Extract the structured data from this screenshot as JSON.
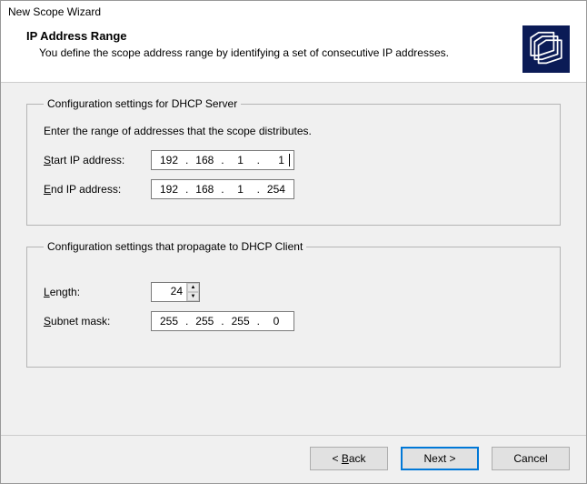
{
  "window": {
    "title": "New Scope Wizard"
  },
  "header": {
    "heading": "IP Address Range",
    "subtitle": "You define the scope address range by identifying a set of consecutive IP addresses."
  },
  "server": {
    "legend": "Configuration settings for DHCP Server",
    "intro": "Enter the range of addresses that the scope distributes.",
    "start_label_pre": "S",
    "start_label_post": "tart IP address:",
    "start_ip": {
      "a": "192",
      "b": "168",
      "c": "1",
      "d": "1"
    },
    "end_label_pre": "E",
    "end_label_post": "nd IP address:",
    "end_ip": {
      "a": "192",
      "b": "168",
      "c": "1",
      "d": "254"
    }
  },
  "client": {
    "legend": "Configuration settings that propagate to DHCP Client",
    "length_label_pre": "L",
    "length_label_post": "ength:",
    "length_value": "24",
    "mask_label_pre": "S",
    "mask_label_post": "ubnet mask:",
    "mask": {
      "a": "255",
      "b": "255",
      "c": "255",
      "d": "0"
    }
  },
  "buttons": {
    "back": "< Back",
    "next": "Next >",
    "cancel": "Cancel"
  }
}
